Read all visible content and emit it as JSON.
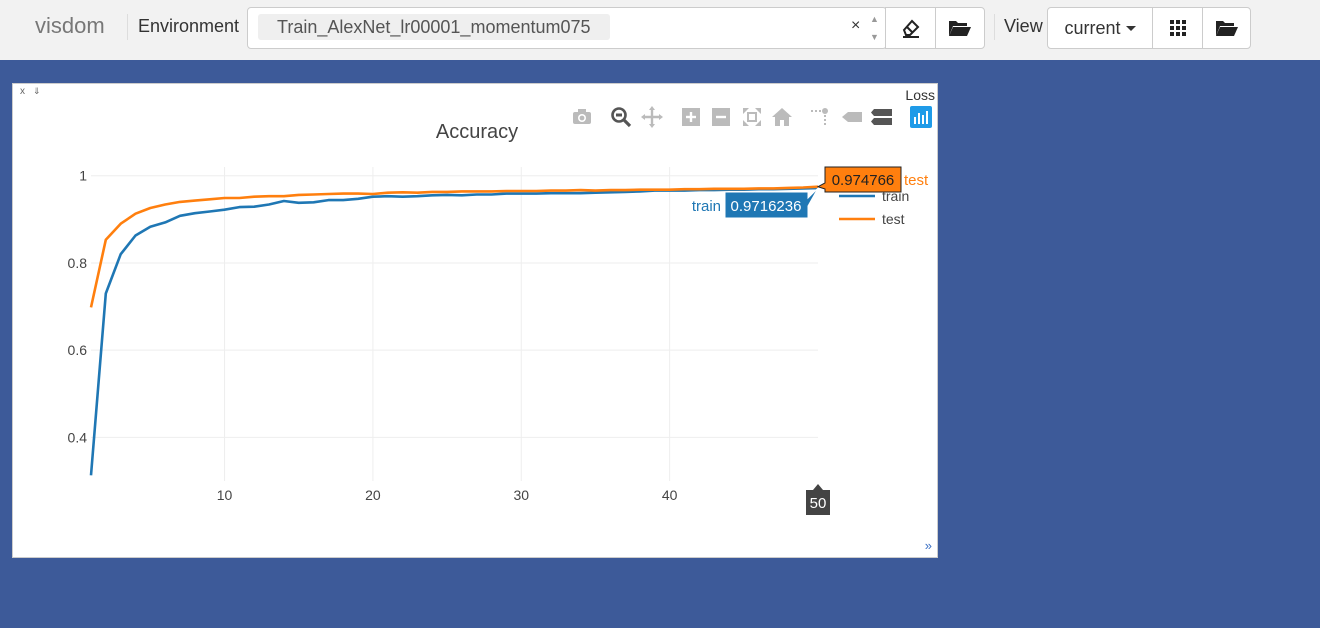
{
  "navbar": {
    "brand": "visdom",
    "environment_label": "Environment",
    "environment_value": "Train_AlexNet_lr00001_momentum075",
    "clear_symbol": "×",
    "view_label": "View",
    "view_value": "current"
  },
  "pane": {
    "title": "Loss",
    "close_symbol": "x",
    "resize_symbol": "»"
  },
  "modebar_icons": [
    "camera-icon",
    "zoom-icon",
    "pan-icon",
    "zoom-in-icon",
    "zoom-out-icon",
    "autoscale-icon",
    "reset-axes-icon",
    "spike-lines-icon",
    "hover-closest-icon",
    "hover-compare-icon",
    "plotly-logo-icon"
  ],
  "colors": {
    "background": "#3d5a99",
    "train": "#1f77b4",
    "test": "#ff7f0e",
    "modebar_active": "#1f9be8"
  },
  "chart_data": {
    "type": "line",
    "title": "Accuracy",
    "xlabel": "",
    "ylabel": "",
    "xlim": [
      1,
      50
    ],
    "ylim": [
      0.3,
      1.02
    ],
    "xticks": [
      10,
      20,
      30,
      40
    ],
    "yticks": [
      0.4,
      0.6,
      0.8,
      1
    ],
    "ytick_labels": [
      "0.4",
      "0.6",
      "0.8",
      "1"
    ],
    "grid": true,
    "legend": "top-right",
    "series": [
      {
        "name": "train",
        "x": [
          1,
          2,
          3,
          4,
          5,
          6,
          7,
          8,
          9,
          10,
          11,
          12,
          13,
          14,
          15,
          16,
          17,
          18,
          19,
          20,
          21,
          22,
          23,
          24,
          25,
          26,
          27,
          28,
          29,
          30,
          31,
          32,
          33,
          34,
          35,
          36,
          37,
          38,
          39,
          40,
          41,
          42,
          43,
          44,
          45,
          46,
          47,
          48,
          49,
          50
        ],
        "y": [
          0.313,
          0.73,
          0.82,
          0.863,
          0.883,
          0.893,
          0.908,
          0.914,
          0.918,
          0.922,
          0.928,
          0.929,
          0.934,
          0.942,
          0.938,
          0.939,
          0.944,
          0.944,
          0.947,
          0.952,
          0.953,
          0.952,
          0.953,
          0.955,
          0.956,
          0.955,
          0.957,
          0.957,
          0.959,
          0.959,
          0.959,
          0.96,
          0.96,
          0.96,
          0.961,
          0.962,
          0.963,
          0.964,
          0.966,
          0.966,
          0.966,
          0.967,
          0.967,
          0.968,
          0.968,
          0.969,
          0.969,
          0.97,
          0.971,
          0.9716236
        ]
      },
      {
        "name": "test",
        "x": [
          1,
          2,
          3,
          4,
          5,
          6,
          7,
          8,
          9,
          10,
          11,
          12,
          13,
          14,
          15,
          16,
          17,
          18,
          19,
          20,
          21,
          22,
          23,
          24,
          25,
          26,
          27,
          28,
          29,
          30,
          31,
          32,
          33,
          34,
          35,
          36,
          37,
          38,
          39,
          40,
          41,
          42,
          43,
          44,
          45,
          46,
          47,
          48,
          49,
          50
        ],
        "y": [
          0.698,
          0.853,
          0.89,
          0.913,
          0.926,
          0.934,
          0.94,
          0.943,
          0.946,
          0.949,
          0.949,
          0.952,
          0.953,
          0.953,
          0.956,
          0.957,
          0.958,
          0.959,
          0.959,
          0.958,
          0.961,
          0.962,
          0.961,
          0.963,
          0.963,
          0.964,
          0.964,
          0.964,
          0.965,
          0.965,
          0.965,
          0.966,
          0.966,
          0.967,
          0.966,
          0.967,
          0.967,
          0.968,
          0.968,
          0.968,
          0.969,
          0.969,
          0.97,
          0.97,
          0.97,
          0.971,
          0.971,
          0.972,
          0.973,
          0.974766
        ]
      }
    ],
    "hover": {
      "x_label": "50",
      "train_label": "train",
      "train_value": "0.9716236",
      "test_label": "test",
      "test_value": "0.974766"
    }
  }
}
